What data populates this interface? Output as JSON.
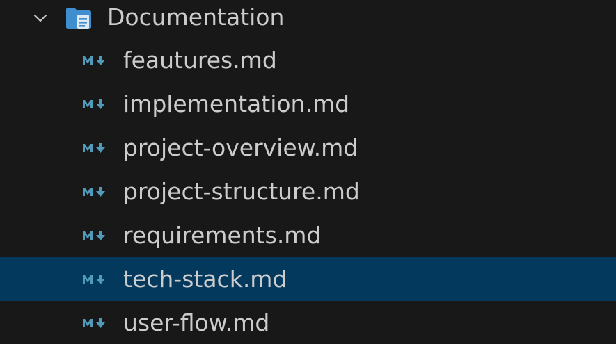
{
  "folder": {
    "label": "Documentation",
    "expanded": true,
    "icon": "folder-docs-icon"
  },
  "files": [
    {
      "label": "feautures.md",
      "icon": "markdown-icon",
      "selected": false
    },
    {
      "label": "implementation.md",
      "icon": "markdown-icon",
      "selected": false
    },
    {
      "label": "project-overview.md",
      "icon": "markdown-icon",
      "selected": false
    },
    {
      "label": "project-structure.md",
      "icon": "markdown-icon",
      "selected": false
    },
    {
      "label": "requirements.md",
      "icon": "markdown-icon",
      "selected": false
    },
    {
      "label": "tech-stack.md",
      "icon": "markdown-icon",
      "selected": true
    },
    {
      "label": "user-flow.md",
      "icon": "markdown-icon",
      "selected": false
    }
  ],
  "colors": {
    "background": "#181818",
    "selection": "#04395e",
    "text": "#cccccc",
    "icon_blue": "#519aba",
    "folder_blue": "#4a9fd8"
  }
}
